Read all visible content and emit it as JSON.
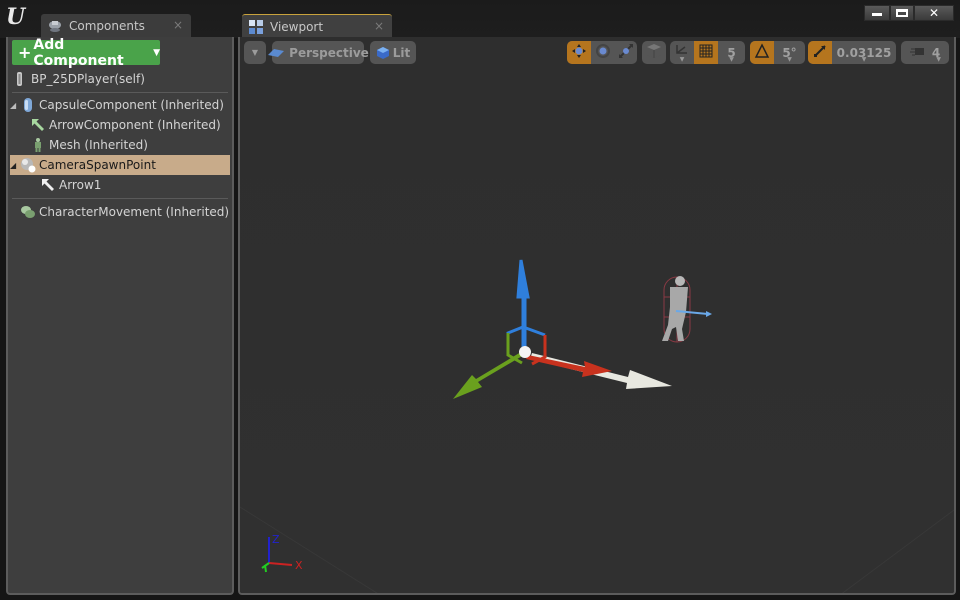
{
  "window": {
    "logo": "U",
    "controls": {
      "minimize": "minimize",
      "maximize": "maximize",
      "close": "✕"
    }
  },
  "tabs": [
    {
      "label": "Components",
      "icon": "components-icon",
      "close": "×"
    },
    {
      "label": "Viewport",
      "icon": "viewport-icon",
      "close": "×"
    }
  ],
  "components_panel": {
    "add_button": {
      "plus": "+",
      "label": "Add Component",
      "caret": "▼"
    },
    "items": [
      {
        "label": "BP_25DPlayer(self)",
        "icon": "actor-icon",
        "expander": "",
        "selected": false
      },
      {
        "label": "CapsuleComponent (Inherited)",
        "icon": "capsule-icon",
        "expander": "◢",
        "selected": false
      },
      {
        "label": "ArrowComponent (Inherited)",
        "icon": "arrow-icon",
        "expander": "",
        "selected": false
      },
      {
        "label": "Mesh (Inherited)",
        "icon": "mesh-icon",
        "expander": "",
        "selected": false
      },
      {
        "label": "CameraSpawnPoint",
        "icon": "scene-component-icon",
        "expander": "◢",
        "selected": true
      },
      {
        "label": "Arrow1",
        "icon": "arrow-icon",
        "expander": "",
        "selected": false
      },
      {
        "label": "CharacterMovement (Inherited)",
        "icon": "movement-icon",
        "expander": "",
        "selected": false
      }
    ]
  },
  "viewport": {
    "toolbar": {
      "options_caret": "▼",
      "perspective_label": "Perspective",
      "lit_label": "Lit",
      "transform_modes": [
        "translate",
        "rotate",
        "scale"
      ],
      "active_transform": "translate",
      "grid_snap_value": "5",
      "rotation_snap_value": "5°",
      "scale_snap_value": "0.03125",
      "camera_speed_value": "4"
    },
    "axis_labels": {
      "x": "X",
      "z": "Z"
    },
    "colors": {
      "x_axis": "#c8321e",
      "y_axis": "#6aa01e",
      "z_axis": "#2f7fdc",
      "accent": "#b5751e"
    }
  }
}
